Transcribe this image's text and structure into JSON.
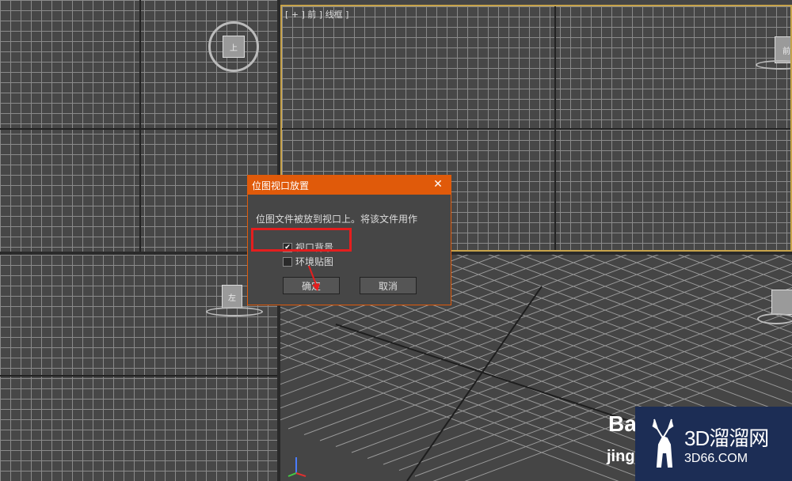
{
  "viewports": {
    "front_label": "[ + ] 前 ] 线框 ]",
    "top_nav_label": "上",
    "front_nav_label": "前",
    "left_nav_label": "左"
  },
  "dialog": {
    "title": "位图视口放置",
    "close_label": "✕",
    "message": "位图文件被放到视口上。将该文件用作",
    "option_viewport_bg": "视口背景",
    "option_viewport_bg_checked": true,
    "option_env_map": "环境贴图",
    "option_env_map_checked": false,
    "ok_label": "确定",
    "cancel_label": "取消"
  },
  "watermark": {
    "brand_cn": "3D溜溜网",
    "brand_url": "3D66.COM",
    "baidu_text": "Ba",
    "baidu_sub": "jing"
  },
  "colors": {
    "accent": "#e05a0a",
    "highlight": "#e41e1e",
    "active_viewport_border": "#c7a34a"
  }
}
